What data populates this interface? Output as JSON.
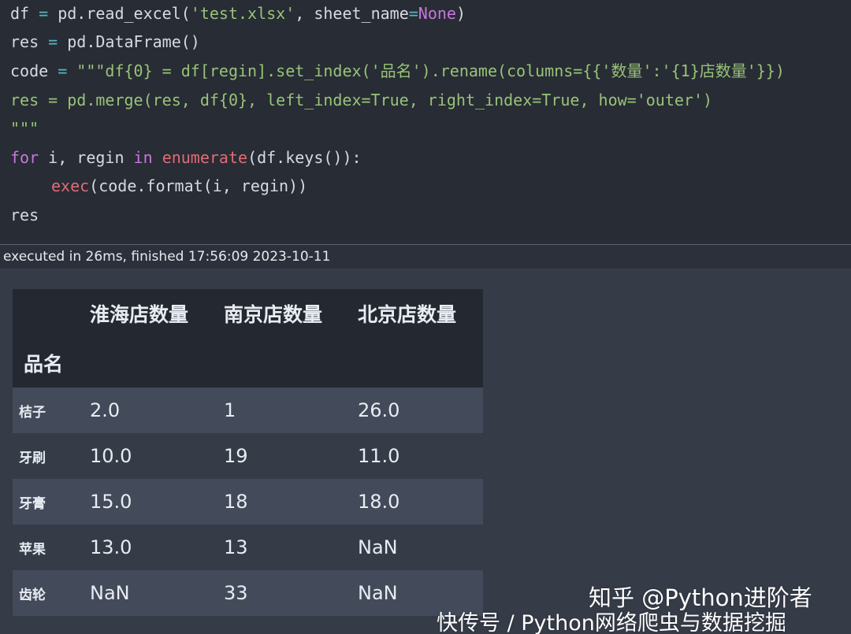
{
  "code_cell": {
    "line1": {
      "a": "df",
      "eq": " = ",
      "b": "pd.read_excel(",
      "s1": "'test.xlsx'",
      "c": ", sheet_name",
      "eq2": "=",
      "none": "None",
      "d": ")"
    },
    "line2": {
      "a": "res",
      "eq": " = ",
      "b": "pd.DataFrame()"
    },
    "line3": {
      "a": "code",
      "eq": " = ",
      "s": "\"\"\"df{0} = df[regin].set_index('品名').rename(columns={{'数量':'{1}店数量'}})"
    },
    "line4": {
      "s": "res = pd.merge(res, df{0}, left_index=True, right_index=True, how='outer')"
    },
    "line5": {
      "s": "\"\"\""
    },
    "line6": {
      "kw1": "for",
      "a": " i, regin ",
      "kw2": "in",
      "sp": " ",
      "fn": "enumerate",
      "b": "(df.keys()):"
    },
    "line7": {
      "fn": "exec",
      "b": "(code.format(i, regin))"
    },
    "line8": {
      "a": "res"
    }
  },
  "status": {
    "text": "executed in 26ms, finished 17:56:09 2023-10-11"
  },
  "dataframe": {
    "columns": [
      "淮海店数量",
      "南京店数量",
      "北京店数量"
    ],
    "index_name": "品名",
    "rows": [
      {
        "index": "桔子",
        "values": [
          "2.0",
          "1",
          "26.0"
        ]
      },
      {
        "index": "牙刷",
        "values": [
          "10.0",
          "19",
          "11.0"
        ]
      },
      {
        "index": "牙膏",
        "values": [
          "15.0",
          "18",
          "18.0"
        ]
      },
      {
        "index": "苹果",
        "values": [
          "13.0",
          "13",
          "NaN"
        ]
      },
      {
        "index": "齿轮",
        "values": [
          "NaN",
          "33",
          "NaN"
        ]
      }
    ]
  },
  "watermark": {
    "line1": "知乎 @Python进阶者",
    "line2": "快传号 / Python网络爬虫与数据挖掘"
  },
  "colors": {
    "code_background": "#282c34",
    "output_background": "#353b47",
    "keyword": "#c678dd",
    "string": "#98c379",
    "function": "#e06c75",
    "constant": "#d19a66",
    "operator": "#56b6c2"
  }
}
